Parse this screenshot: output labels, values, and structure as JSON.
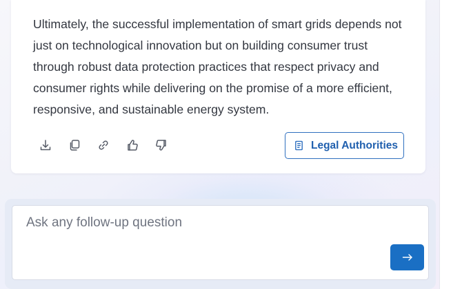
{
  "response": {
    "text": "Ultimately, the successful implementation of smart grids depends not just on technological innovation but on building consumer trust through robust data protection practices that respect privacy and consumer rights while delivering on the promise of a more efficient, responsive, and sustainable energy system."
  },
  "toolbar": {
    "icons": [
      "download-icon",
      "copy-icon",
      "link-icon",
      "thumbs-up-icon",
      "thumbs-down-icon"
    ]
  },
  "legal_button": {
    "label": "Legal Authorities",
    "icon": "document-icon"
  },
  "followup": {
    "placeholder": "Ask any follow-up question",
    "send_icon": "arrow-right-icon"
  },
  "colors": {
    "accent": "#1a6fc4",
    "accent_text": "#1f5fae",
    "body_text": "#333740"
  }
}
